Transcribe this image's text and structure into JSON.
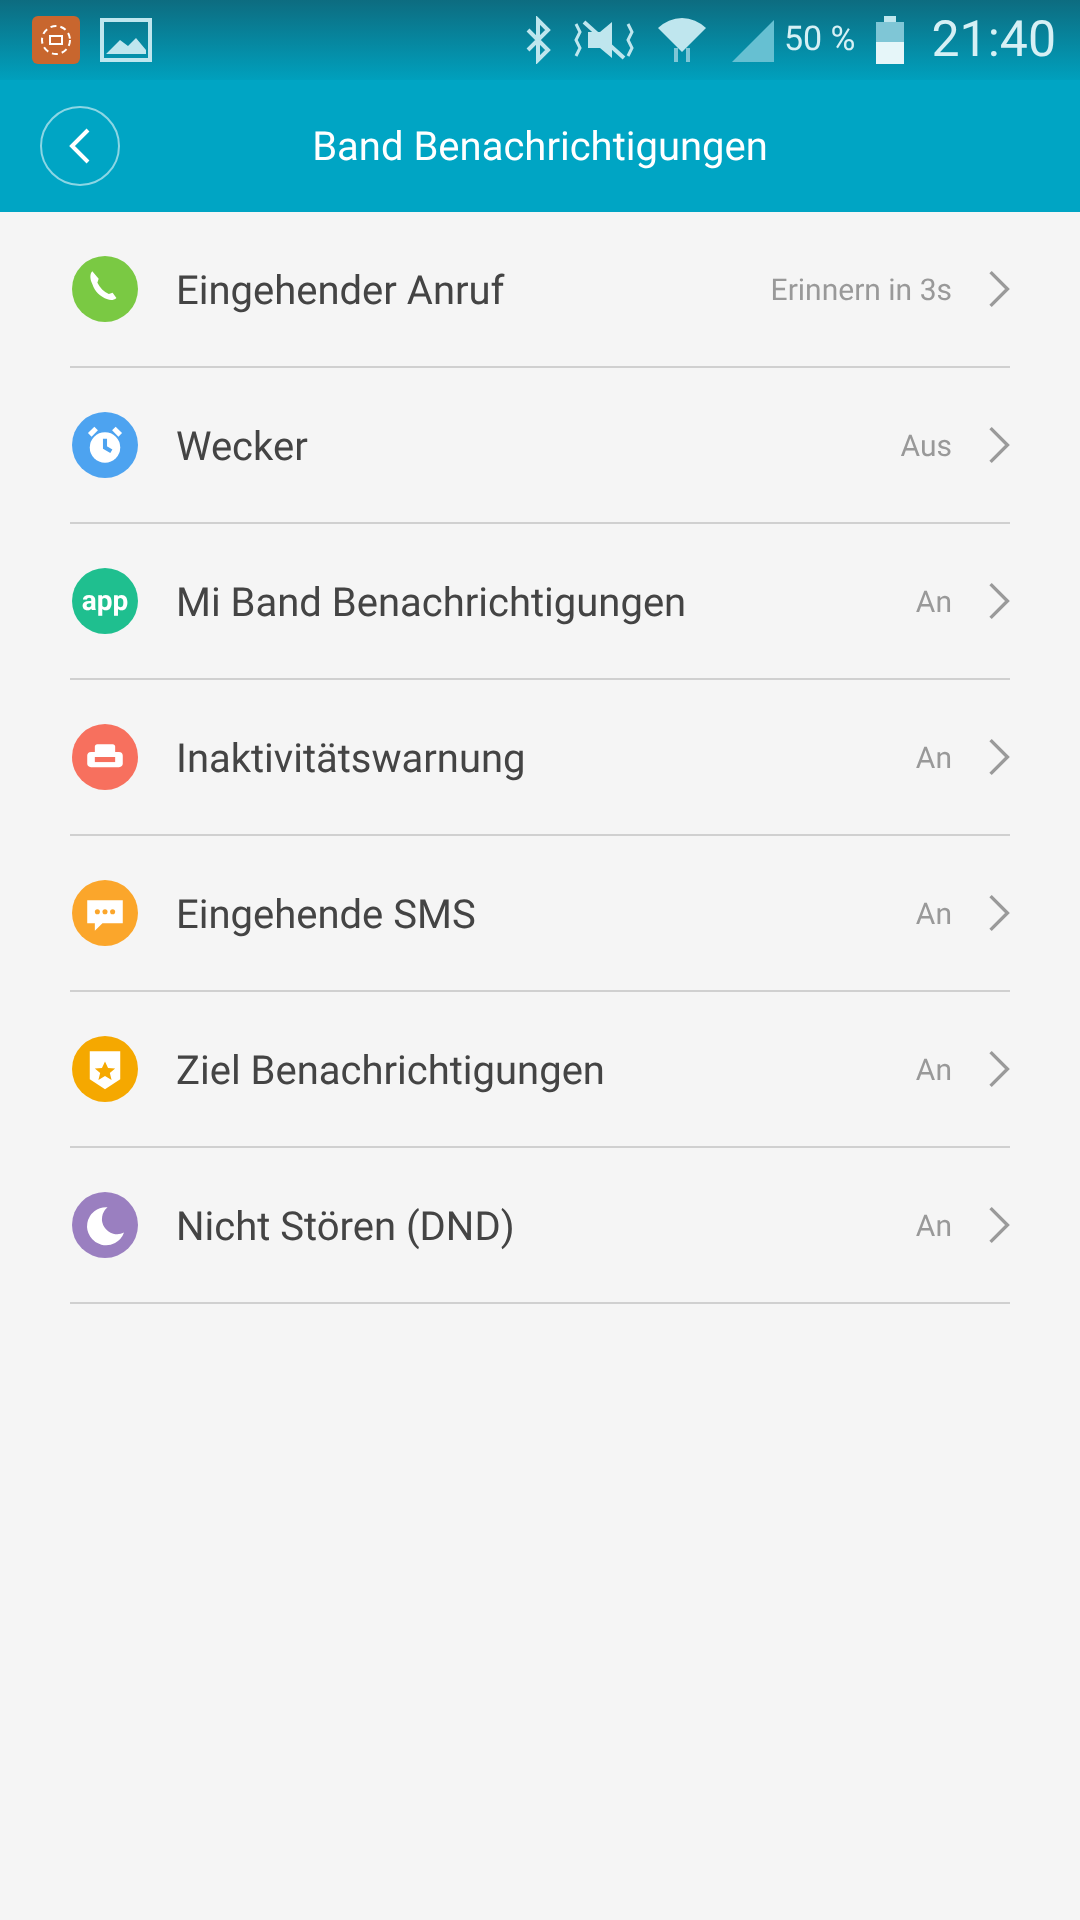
{
  "status_bar": {
    "battery": "50 %",
    "time": "21:40"
  },
  "header": {
    "title": "Band Benachrichtigungen"
  },
  "items": [
    {
      "kind": "phone",
      "color": "#7ac943",
      "label": "Eingehender Anruf",
      "value": "Erinnern in 3s"
    },
    {
      "kind": "alarm",
      "color": "#4da3f0",
      "label": "Wecker",
      "value": "Aus"
    },
    {
      "kind": "app",
      "color": "#1fbf8f",
      "badge_text": "app",
      "label": "Mi Band Benachrichtigungen",
      "value": "An"
    },
    {
      "kind": "sofa",
      "color": "#f7705e",
      "label": "Inaktivitätswarnung",
      "value": "An"
    },
    {
      "kind": "sms",
      "color": "#fba62b",
      "label": "Eingehende SMS",
      "value": "An"
    },
    {
      "kind": "goal",
      "color": "#f5a800",
      "label": "Ziel Benachrichtigungen",
      "value": "An"
    },
    {
      "kind": "moon",
      "color": "#9a7fc0",
      "label": "Nicht Stören (DND)",
      "value": "An"
    }
  ]
}
